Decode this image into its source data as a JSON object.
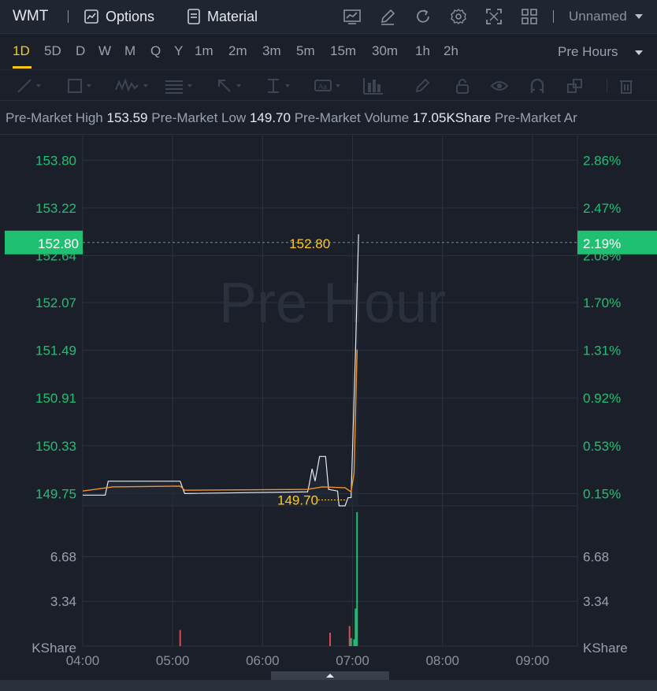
{
  "topbar": {
    "ticker": "WMT",
    "options_label": "Options",
    "material_label": "Material",
    "layout_name": "Unnamed",
    "tools": [
      "chart-indicator-icon",
      "pen-edit-icon",
      "refresh-icon",
      "settings-gear-icon",
      "fullscreen-icon",
      "layout-grid-icon"
    ]
  },
  "periods": [
    {
      "label": "1D",
      "active": true
    },
    {
      "label": "5D",
      "active": false
    },
    {
      "label": "D",
      "active": false
    },
    {
      "label": "W",
      "active": false
    },
    {
      "label": "M",
      "active": false
    },
    {
      "label": "Q",
      "active": false
    },
    {
      "label": "Y",
      "active": false
    },
    {
      "label": "1m",
      "active": false
    },
    {
      "label": "2m",
      "active": false
    },
    {
      "label": "3m",
      "active": false
    },
    {
      "label": "5m",
      "active": false
    },
    {
      "label": "15m",
      "active": false
    },
    {
      "label": "30m",
      "active": false
    },
    {
      "label": "1h",
      "active": false
    },
    {
      "label": "2h",
      "active": false
    }
  ],
  "session_select": "Pre Hours",
  "drawing_tools": [
    "trend-line-icon",
    "rectangle-icon",
    "wave-pattern-icon",
    "fibonacci-icon",
    "arrow-icon",
    "measure-icon",
    "text-label-icon",
    "volume-profile-icon",
    "brush-icon",
    "lock-icon",
    "eye-icon",
    "magnet-icon",
    "layers-icon",
    "trash-icon"
  ],
  "info": {
    "high_label": "Pre-Market High",
    "high_value": "153.59",
    "low_label": "Pre-Market Low",
    "low_value": "149.70",
    "volume_label": "Pre-Market Volume",
    "volume_value": "17.05KShare",
    "amount_label": "Pre-Market Ar"
  },
  "watermark": "Pre Hour",
  "colors": {
    "up": "#20c073",
    "down": "#e04a4a",
    "accent": "#ffc81a",
    "price_line": "#e6e8ee",
    "avg_line": "#f0932b"
  },
  "chart_data": {
    "type": "line",
    "x_axis": {
      "ticks": [
        "04:00",
        "05:00",
        "06:00",
        "07:00",
        "08:00",
        "09:00"
      ],
      "range": [
        "04:00",
        "09:30"
      ]
    },
    "price_axis": {
      "ticks": [
        "153.80",
        "153.22",
        "152.64",
        "152.07",
        "151.49",
        "150.91",
        "150.33",
        "149.75"
      ],
      "percent_ticks": [
        "2.86%",
        "2.47%",
        "2.08%",
        "1.70%",
        "1.31%",
        "0.92%",
        "0.53%",
        "0.15%"
      ],
      "range": [
        149.6,
        154.1
      ]
    },
    "current_price": {
      "value": "152.80",
      "percent": "2.19%"
    },
    "high_marker": "152.80",
    "low_marker": "149.70",
    "price_series": [
      [
        "04:00",
        149.73
      ],
      [
        "04:15",
        149.73
      ],
      [
        "04:17",
        149.9
      ],
      [
        "05:05",
        149.9
      ],
      [
        "05:08",
        149.75
      ],
      [
        "06:30",
        149.77
      ],
      [
        "06:31",
        149.85
      ],
      [
        "06:33",
        150.05
      ],
      [
        "06:35",
        149.9
      ],
      [
        "06:38",
        150.2
      ],
      [
        "06:42",
        150.2
      ],
      [
        "06:44",
        149.8
      ],
      [
        "06:50",
        149.78
      ],
      [
        "06:51",
        149.6
      ],
      [
        "06:55",
        149.6
      ],
      [
        "06:57",
        149.7
      ],
      [
        "06:59",
        149.7
      ],
      [
        "07:02",
        151.5
      ],
      [
        "07:04",
        152.9
      ]
    ],
    "avg_series": [
      [
        "04:00",
        149.78
      ],
      [
        "04:20",
        149.83
      ],
      [
        "05:05",
        149.84
      ],
      [
        "05:08",
        149.79
      ],
      [
        "06:30",
        149.8
      ],
      [
        "06:40",
        149.83
      ],
      [
        "06:55",
        149.82
      ],
      [
        "06:59",
        149.77
      ],
      [
        "07:01",
        150.0
      ],
      [
        "07:03",
        151.5
      ]
    ],
    "volume_axis": {
      "ticks": [
        "6.68",
        "3.34"
      ],
      "unit": "KShare",
      "range": [
        0,
        10
      ]
    },
    "volume_bars": [
      [
        "05:05",
        1.2,
        "down"
      ],
      [
        "06:45",
        1.0,
        "down"
      ],
      [
        "06:58",
        1.5,
        "down"
      ],
      [
        "06:59",
        0.6,
        "up"
      ],
      [
        "07:01",
        0.5,
        "up"
      ],
      [
        "07:02",
        2.8,
        "up"
      ],
      [
        "07:03",
        10.0,
        "up"
      ]
    ]
  }
}
